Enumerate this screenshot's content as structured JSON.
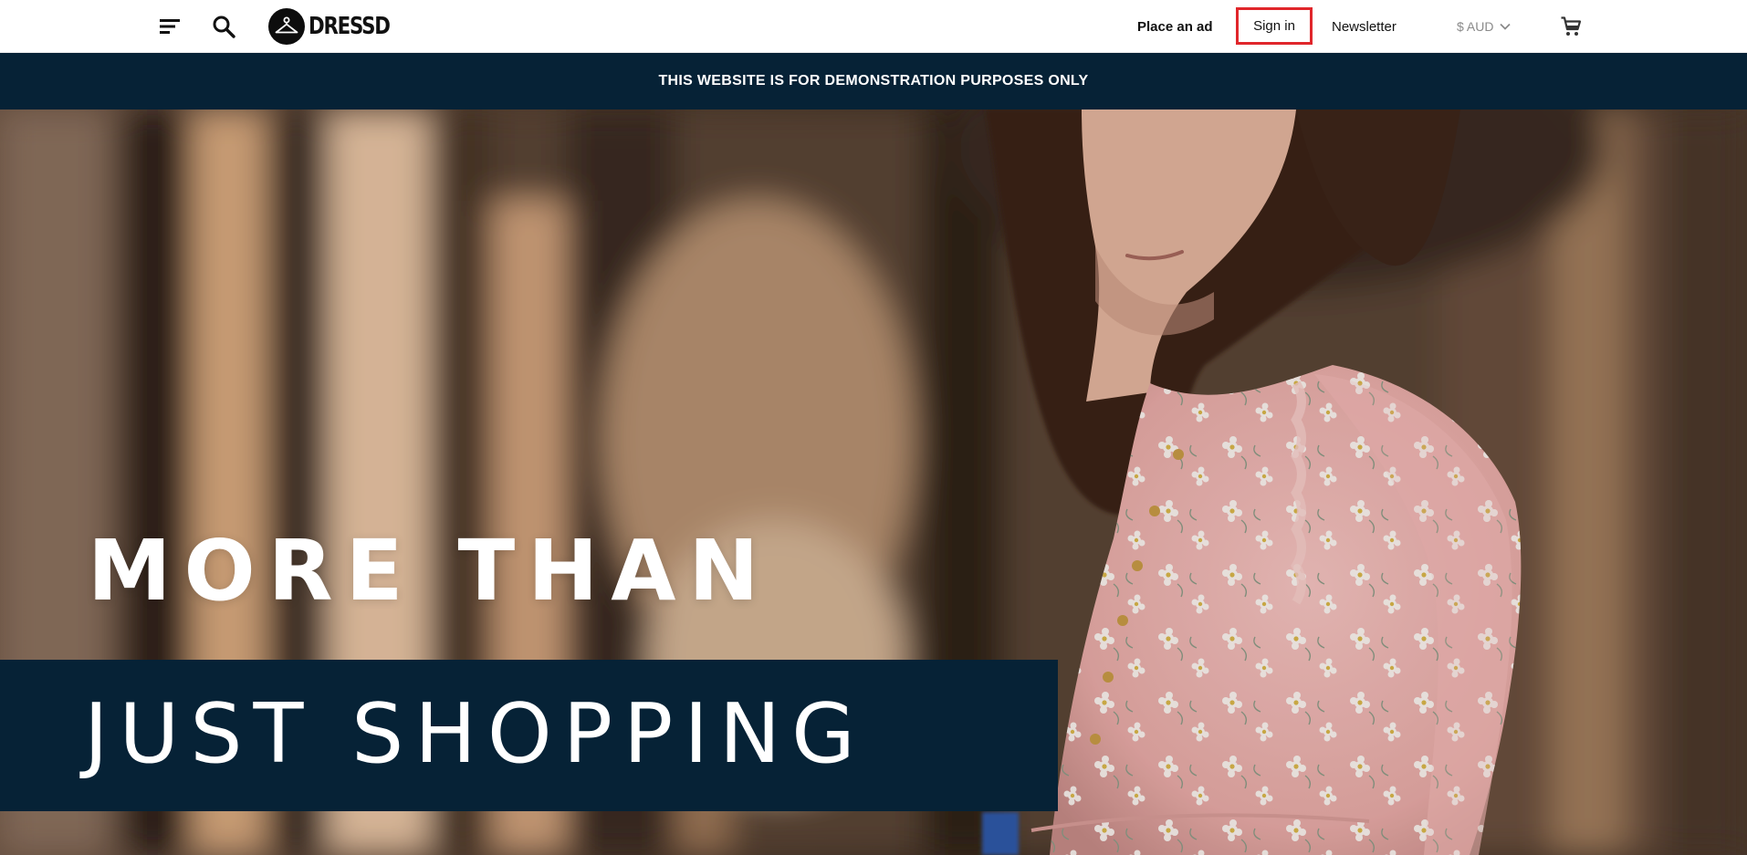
{
  "header": {
    "logo_text": "DRESSD",
    "nav": {
      "place_ad": "Place an ad",
      "sign_in": "Sign in",
      "newsletter": "Newsletter",
      "currency": "$ AUD"
    },
    "icons": {
      "menu": "menu-icon",
      "search": "search-icon",
      "logo": "hanger-icon",
      "dropdown": "chevron-down-icon",
      "cart": "cart-icon"
    },
    "highlight_color": "#e0262b"
  },
  "banner": {
    "text": "THIS WEBSITE IS FOR DEMONSTRATION PURPOSES ONLY",
    "background": "#062236"
  },
  "hero": {
    "line1": "MORE THAN",
    "line2": "JUST SHOPPING",
    "band_color": "#062236"
  }
}
